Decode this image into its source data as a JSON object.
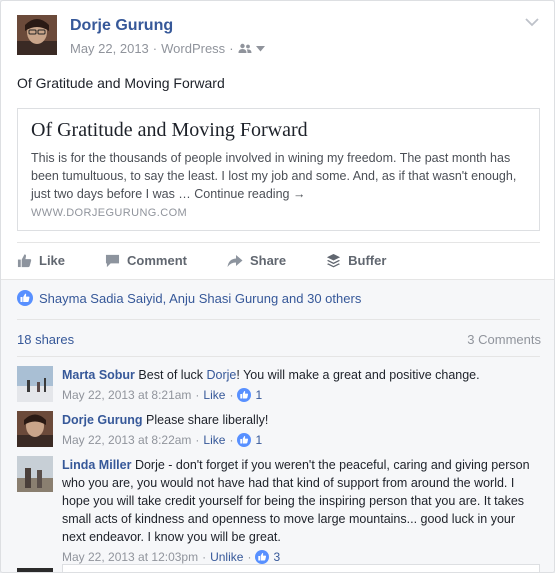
{
  "post": {
    "author": "Dorje Gurung",
    "date": "May 22, 2013",
    "source": "WordPress",
    "text": "Of Gratitude and Moving Forward"
  },
  "link_preview": {
    "title": "Of Gratitude and Moving Forward",
    "description": "This is for the thousands of people involved in wining my freedom. The past month has been tumultuous, to say the least. I lost my job and some. And, as if that wasn't enough, just two days before I was … Continue reading →",
    "domain": "WWW.DORJEGURUNG.COM"
  },
  "actions": {
    "like": "Like",
    "comment": "Comment",
    "share": "Share",
    "buffer": "Buffer"
  },
  "reactions": {
    "likers": "Shayma Sadia Saiyid, Anju Shasi Gurung and 30 others",
    "shares": "18 shares",
    "comments_count": "3 Comments"
  },
  "comments": [
    {
      "author": "Marta Sobur",
      "text_before": "Best of luck ",
      "mention": "Dorje",
      "text_after": "! You will make a great and positive change.",
      "time": "May 22, 2013 at 8:21am",
      "action": "Like",
      "likes": "1"
    },
    {
      "author": "Dorje Gurung",
      "text_before": "Please share liberally!",
      "mention": "",
      "text_after": "",
      "time": "May 22, 2013 at 8:22am",
      "action": "Like",
      "likes": "1"
    },
    {
      "author": "Linda Miller",
      "text_before": "Dorje - don't forget if you weren't the peaceful, caring and giving person who you are, you would not have had that kind of support from around the world. I hope you will take credit yourself for being the inspiring person that you are. It takes small acts of kindness and openness to move large mountains... good luck in your next endeavor. I know you will be great.",
      "mention": "",
      "text_after": "",
      "time": "May 22, 2013 at 12:03pm",
      "action": "Unlike",
      "likes": "3"
    }
  ],
  "meta_separator": " · ",
  "colors": {
    "link": "#365899",
    "muted": "#90949c",
    "like_blue": "#5890ff"
  }
}
